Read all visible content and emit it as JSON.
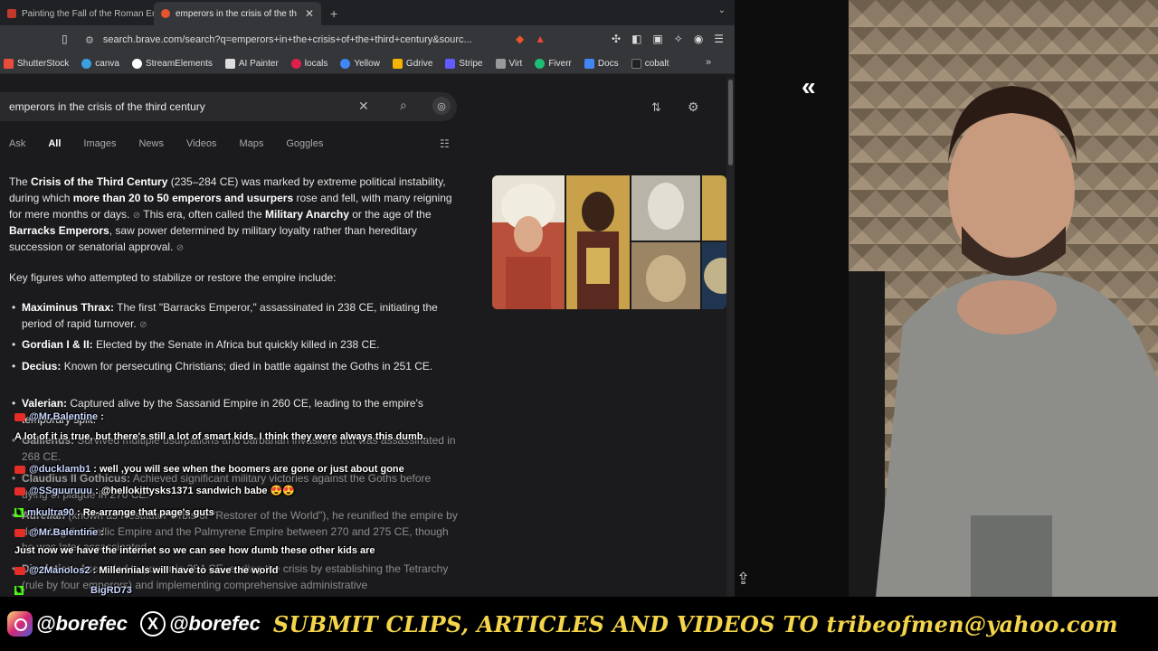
{
  "browser": {
    "tabs": [
      {
        "label": "Painting the Fall of the Roman Emp",
        "active": false
      },
      {
        "label": "emperors in the crisis of the th",
        "active": true
      }
    ],
    "new_tab": "+",
    "url": "search.brave.com/search?q=emperors+in+the+crisis+of+the+third+century&sourc...",
    "bookmarks": [
      "ShutterStock",
      "canva",
      "StreamElements",
      "AI Painter",
      "locals",
      "Yellow",
      "Gdrive",
      "Stripe",
      "Virt",
      "Fiverr",
      "Docs",
      "cobalt"
    ],
    "bookmarks_more": "»"
  },
  "search": {
    "query": "emperors in the crisis of the third century",
    "tabs": [
      "Ask",
      "All",
      "Images",
      "News",
      "Videos",
      "Maps",
      "Goggles"
    ],
    "active_tab": "All",
    "answer": {
      "p1_a": "The ",
      "p1_b": "Crisis of the Third Century",
      "p1_c": " (235–284 CE) was marked by extreme political instability, during which ",
      "p1_d": "more than 20 to 50 emperors and usurpers",
      "p1_e": " rose and fell, with many reigning for mere months or days.",
      "p1_f": " This era, often called the ",
      "p1_g": "Military Anarchy",
      "p1_h": " or the age of the ",
      "p1_i": "Barracks Emperors",
      "p1_j": ", saw power determined by military loyalty rather than hereditary succession or senatorial approval."
    },
    "key_figures_intro": "Key figures who attempted to stabilize or restore the empire include:",
    "figures": [
      {
        "name": "Maximinus Thrax:",
        "text": " The first \"Barracks Emperor,\" assassinated in 238 CE, initiating the period of rapid turnover."
      },
      {
        "name": "Gordian I & II:",
        "text": " Elected by the Senate in Africa but quickly killed in 238 CE."
      },
      {
        "name": "Decius:",
        "text": " Known for persecuting Christians; died in battle against the Goths in 251 CE."
      },
      {
        "name": "Valerian:",
        "text": " Captured alive by the Sassanid Empire in 260 CE, leading to the empire's temporary split."
      },
      {
        "name": "Gallienus:",
        "text": " Survived multiple usurpations and barbarian invasions but was assassinated in 268 CE."
      },
      {
        "name": "Claudius II Gothicus:",
        "text": " Achieved significant military victories against the Goths before dying of plague in 270 CE."
      },
      {
        "name": "Aurelian",
        "text": " (known as Restitutor Orbis or \"Restorer of the World\"), he reunified the empire by defeating the Gallic Empire and the Palmyrene Empire between 270 and 275 CE, though he was later assassinated."
      },
      {
        "name": "Diocletian:",
        "text": " Ascended to power in 284 CE, ending the crisis by establishing the Tetrarchy (rule by four emperors) and implementing comprehensive administrative"
      }
    ]
  },
  "chat": [
    {
      "user": "@Mr.Balentine",
      "msg": ":",
      "platform": "youtube"
    },
    {
      "user": "",
      "msg": "A lot of it is true, but there's still a lot of smart kids. I think they were always this dumb.",
      "platform": "none"
    },
    {
      "user": "@ducklamb1",
      "msg": ": well ,you will see when the boomers are gone or just about gone",
      "platform": "youtube"
    },
    {
      "user": "@SSguuruuu",
      "msg": ": @hellokittysks1371 sandwich babe 😍😍",
      "platform": "youtube"
    },
    {
      "user": "mkultra90",
      "msg": ": Re-arrange that page's guts",
      "platform": "kick"
    },
    {
      "user": "@Mr.Balentine",
      "msg": ":",
      "platform": "youtube"
    },
    {
      "user": "",
      "msg": "Just now we have the internet so we can see how dumb these other kids are",
      "platform": "none"
    },
    {
      "user": "@2Manolos2",
      "msg": ": Millennials will have to save the world",
      "platform": "youtube"
    },
    {
      "user": "BigRD73",
      "msg": "",
      "platform": "kick"
    }
  ],
  "banner": {
    "instagram": "@borefec",
    "x": "@borefec",
    "x_glyph": "X",
    "cta": "SUBMIT CLIPS, ARTICLES AND VIDEOS TO tribeofmen@yahoo.com"
  },
  "colors": {
    "banner_text": "#f3d44a",
    "page_bg": "#1b1b1d"
  }
}
